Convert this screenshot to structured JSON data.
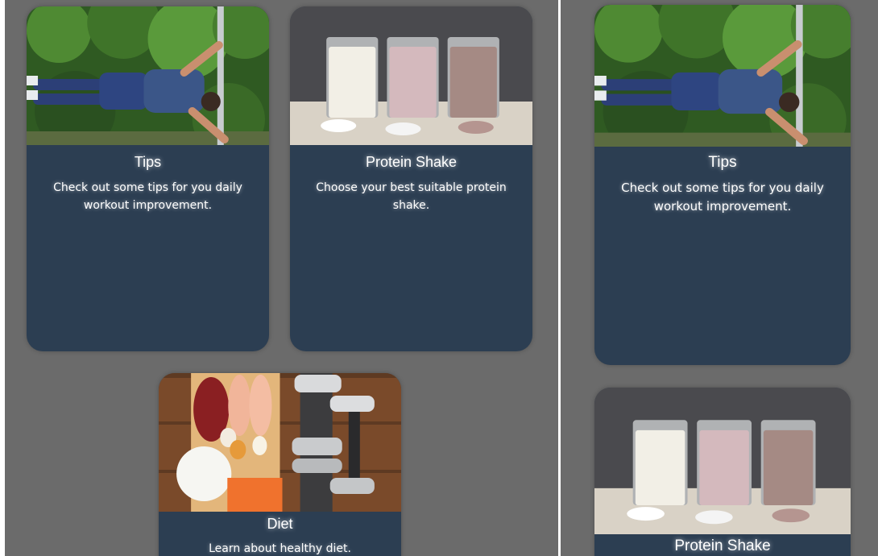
{
  "left_view": {
    "cards": {
      "tips": {
        "title": "Tips",
        "description": "Check out some tips for you daily workout improvement.",
        "image": "calisthenics-flag-photo"
      },
      "protein": {
        "title": "Protein Shake",
        "description": "Choose your best suitable protein shake.",
        "image": "protein-shakes-photo"
      },
      "diet": {
        "title": "Diet",
        "description": "Learn about healthy diet.",
        "image": "diet-food-dumbbells-photo"
      }
    }
  },
  "right_view": {
    "cards": {
      "tips": {
        "title": "Tips",
        "description": "Check out some tips for you daily workout improvement.",
        "image": "calisthenics-flag-photo"
      },
      "protein": {
        "title": "Protein Shake",
        "image": "protein-shakes-photo"
      }
    }
  },
  "colors": {
    "page_background": "#6b6b6b",
    "card_background": "#2c3e52",
    "text": "#ffffff"
  }
}
